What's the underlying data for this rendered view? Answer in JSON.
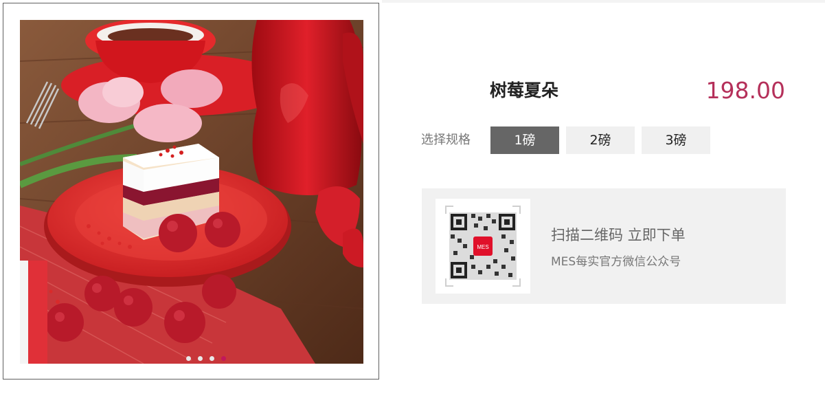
{
  "product": {
    "name": "树莓夏朵",
    "price": "198.00"
  },
  "spec": {
    "label": "选择规格",
    "options": [
      "1磅",
      "2磅",
      "3磅"
    ],
    "selected_index": 0
  },
  "gallery": {
    "slide_count": 4,
    "active_slide": 4
  },
  "qr": {
    "logo_text": "MES",
    "main_text": "扫描二维码 立即下单",
    "sub_text": "MES每实官方微信公众号"
  },
  "colors": {
    "price": "#b5305a",
    "selected_spec_bg": "#666666",
    "active_dot": "#c2185b"
  }
}
